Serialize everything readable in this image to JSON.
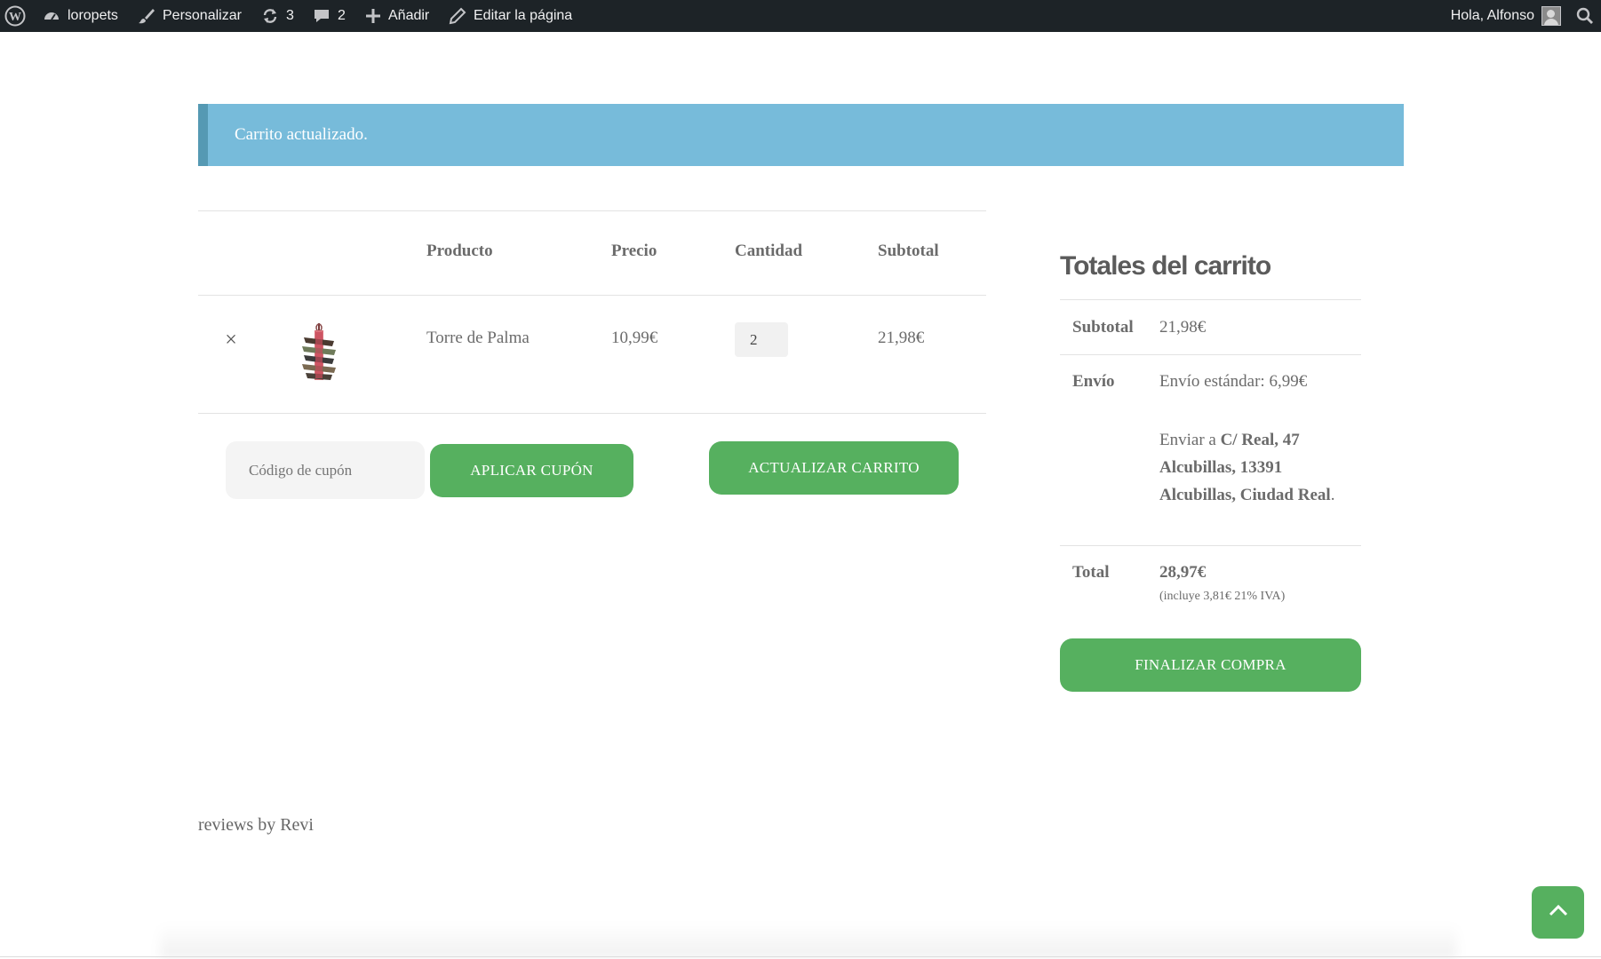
{
  "admin_bar": {
    "site_name": "loropets",
    "customize": "Personalizar",
    "updates_count": "3",
    "comments_count": "2",
    "add_new": "Añadir",
    "edit_page": "Editar la página",
    "greeting": "Hola, Alfonso"
  },
  "notice": {
    "message": "Carrito actualizado."
  },
  "cart": {
    "headers": {
      "product": "Producto",
      "price": "Precio",
      "quantity": "Cantidad",
      "subtotal": "Subtotal"
    },
    "items": [
      {
        "remove_symbol": "×",
        "name": "Torre de Palma",
        "price": "10,99€",
        "quantity": "2",
        "subtotal": "21,98€"
      }
    ],
    "coupon_placeholder": "Código de cupón",
    "apply_coupon": "APLICAR CUPÓN",
    "update_cart": "ACTUALIZAR CARRITO"
  },
  "totals": {
    "title": "Totales del carrito",
    "subtotal_label": "Subtotal",
    "subtotal_value": "21,98€",
    "shipping_label": "Envío",
    "shipping_method": "Envío estándar: 6,99€",
    "ship_to_prefix": "Enviar a",
    "address_line1": "C/ Real, 47",
    "address_line2": "Alcubillas, 13391",
    "address_line3": "Alcubillas, Ciudad Real",
    "address_end": ".",
    "total_label": "Total",
    "total_value": "28,97€",
    "tax_note": "(incluye 3,81€ 21% IVA)",
    "checkout": "FINALIZAR COMPRA"
  },
  "footer": {
    "reviews": "reviews by Revi"
  },
  "colors": {
    "admin_bar": "#1d2327",
    "notice": "#77bbda",
    "button": "#56b05f"
  },
  "icons": [
    "wordpress-icon",
    "dashboard-icon",
    "brush-icon",
    "updates-icon",
    "comment-icon",
    "plus-icon",
    "pencil-icon",
    "search-icon",
    "close-icon",
    "chevron-up-icon"
  ]
}
